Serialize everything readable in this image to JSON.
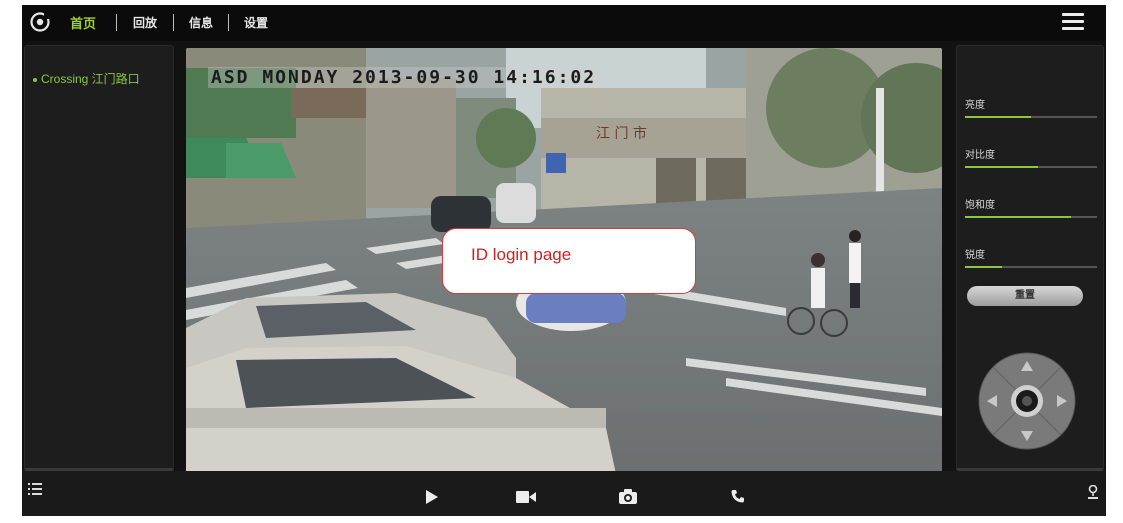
{
  "nav": {
    "items": [
      {
        "label": "首页",
        "active": true
      },
      {
        "label": "回放",
        "active": false
      },
      {
        "label": "信息",
        "active": false
      },
      {
        "label": "设置",
        "active": false
      }
    ],
    "menu_icon": "hamburger-menu-icon"
  },
  "left_panel": {
    "camera": "Crossing 江门路口"
  },
  "video": {
    "osd_text": "ASD MONDAY 2013-09-30 14:16:02",
    "callout_text": "ID login page",
    "sign_text": "江 门 市"
  },
  "right_panel": {
    "sliders": [
      {
        "label": "亮度",
        "value": 0.5
      },
      {
        "label": "对比度",
        "value": 0.55
      },
      {
        "label": "饱和度",
        "value": 0.8
      },
      {
        "label": "锐度",
        "value": 0.28
      }
    ],
    "reset_label": "重置"
  },
  "bottom_bar": {
    "icons": [
      "list-icon",
      "play-icon",
      "record-icon",
      "snapshot-icon",
      "phone-icon",
      "location-icon"
    ]
  },
  "colors": {
    "accent": "#8ec63f",
    "background": "#121212",
    "callout_border": "#d63a3a",
    "callout_text": "#d41f1f"
  }
}
